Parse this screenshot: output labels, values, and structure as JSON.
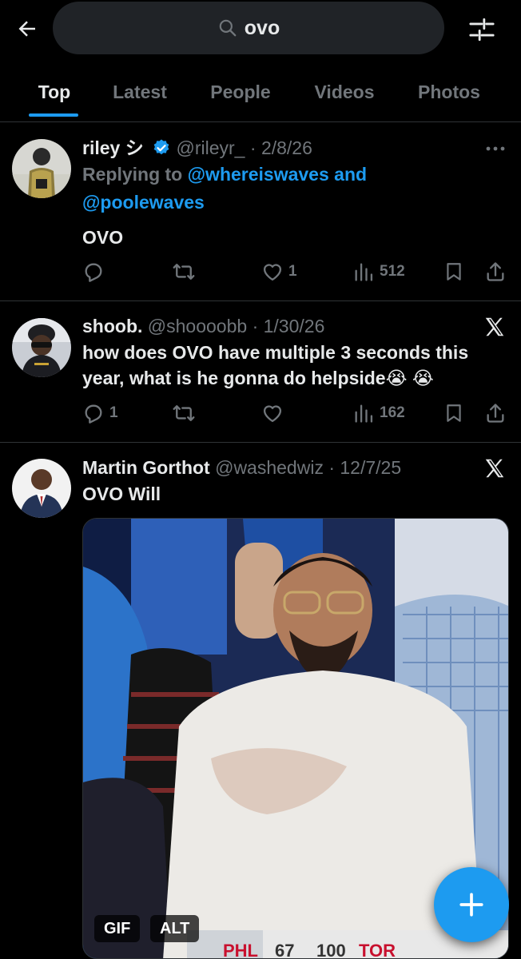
{
  "search": {
    "query": "ovo"
  },
  "tabs": [
    {
      "label": "Top",
      "active": true
    },
    {
      "label": "Latest",
      "active": false
    },
    {
      "label": "People",
      "active": false
    },
    {
      "label": "Videos",
      "active": false
    },
    {
      "label": "Photos",
      "active": false
    }
  ],
  "posts": [
    {
      "display_name": "riley シ",
      "verified": true,
      "handle": "@rileyr_",
      "separator": "·",
      "date": "2/8/26",
      "replying_prefix": "Replying to",
      "replying_user1": "@whereiswaves",
      "replying_and": "and",
      "replying_user2": "@poolewaves",
      "text": "OVO",
      "replies": "",
      "reposts": "",
      "likes": "1",
      "views": "512"
    },
    {
      "display_name": "shoob.",
      "handle": "@shoooobb",
      "separator": "·",
      "date": "1/30/26",
      "text": "how does OVO have multiple 3 seconds this year, what is he gonna do helpside😭 😭",
      "replies": "1",
      "reposts": "",
      "likes": "",
      "views": "162"
    },
    {
      "display_name": "Martin Gorthot",
      "handle": "@washedwiz",
      "separator": "·",
      "date": "12/7/25",
      "text": "OVO Will",
      "media_badges": {
        "gif": "GIF",
        "alt": "ALT"
      },
      "scoreboard": {
        "team1": "PHL",
        "score1": "67",
        "score2": "100",
        "team2": "TOR"
      }
    }
  ],
  "icons": {
    "back": "back-arrow-icon",
    "search": "search-icon",
    "filter": "filter-sliders-icon",
    "more": "more-dots-icon",
    "x": "x-logo-icon",
    "compose": "plus-icon"
  },
  "colors": {
    "accent": "#1d9bf0",
    "background": "#000000",
    "muted": "#71767b",
    "text": "#e7e9ea"
  }
}
